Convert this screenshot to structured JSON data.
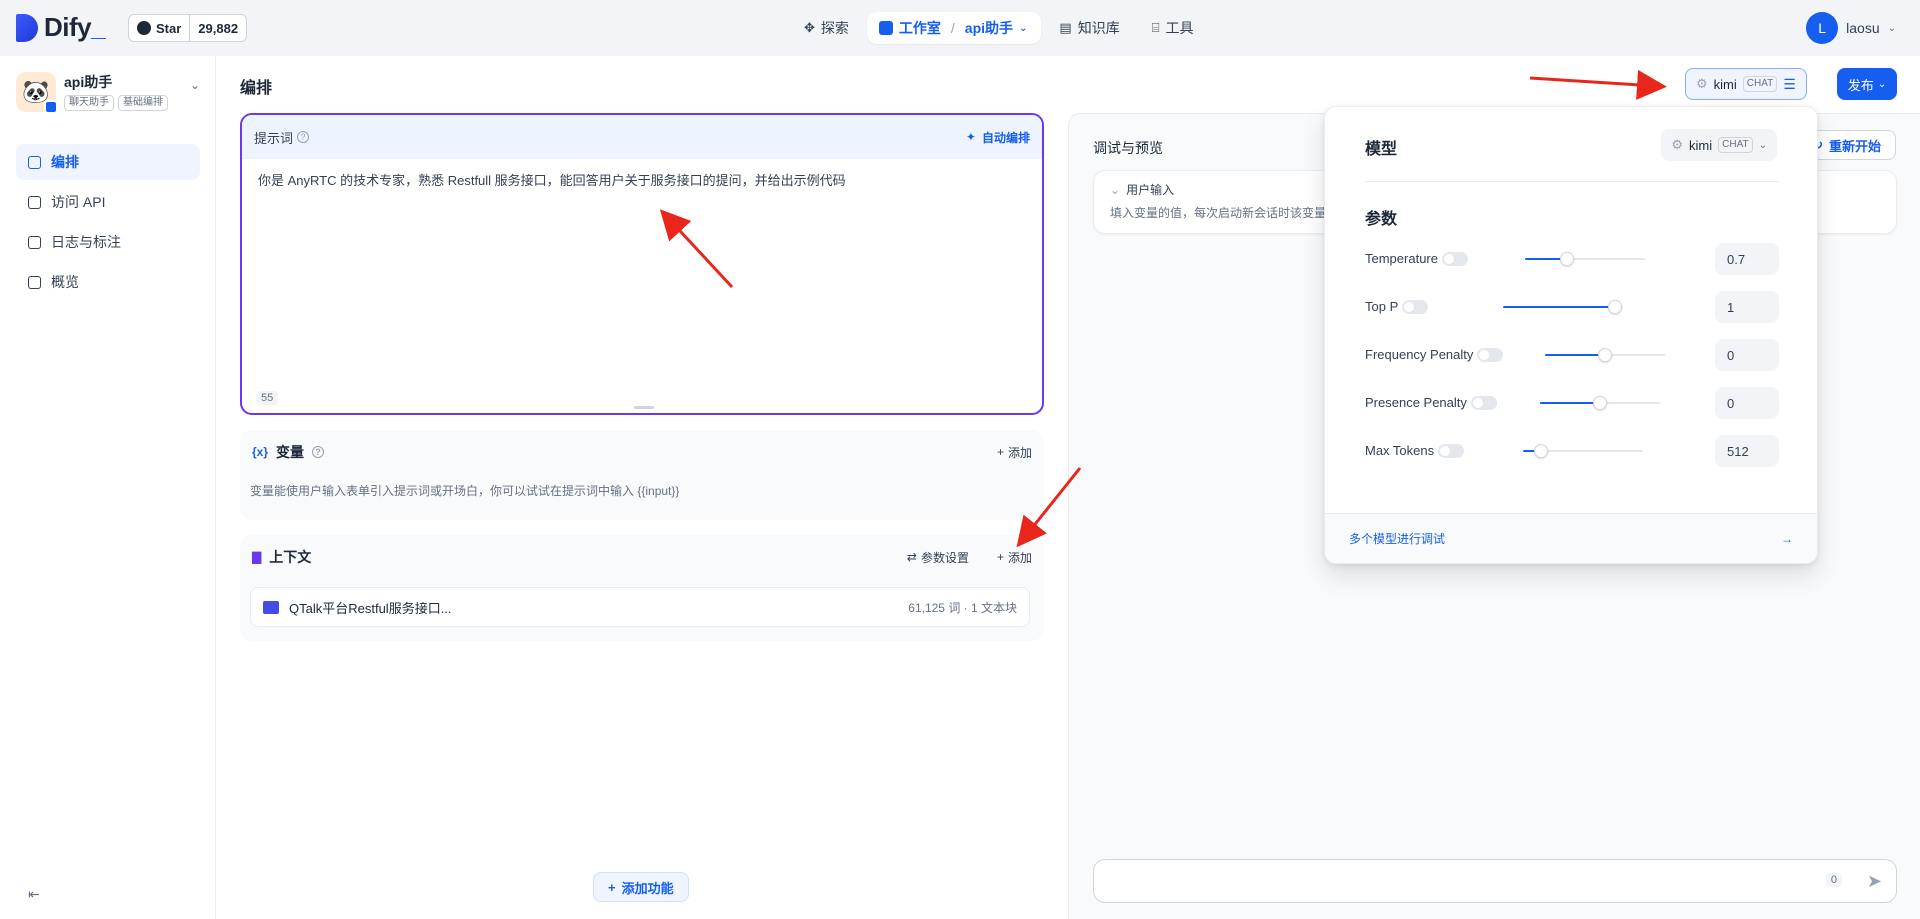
{
  "header": {
    "logo_text": "Dify",
    "github": {
      "label": "Star",
      "count": "29,882"
    },
    "nav": [
      {
        "label": "探索",
        "icon": "compass-icon"
      },
      {
        "label": "工作室",
        "icon": "robot-icon",
        "current_app": "api助手"
      },
      {
        "label": "知识库",
        "icon": "book-icon"
      },
      {
        "label": "工具",
        "icon": "tool-icon"
      }
    ],
    "user": {
      "initial": "L",
      "name": "laosu"
    }
  },
  "sidebar": {
    "app": {
      "name": "api助手",
      "tags": [
        "聊天助手",
        "基础编排"
      ]
    },
    "items": [
      {
        "label": "编排",
        "active": true
      },
      {
        "label": "访问 API",
        "active": false
      },
      {
        "label": "日志与标注",
        "active": false
      },
      {
        "label": "概览",
        "active": false
      }
    ]
  },
  "main": {
    "title": "编排",
    "model_button": {
      "name": "kimi",
      "badge": "CHAT"
    },
    "publish_label": "发布",
    "prompt": {
      "title": "提示词",
      "auto_label": "自动编排",
      "text": "你是 AnyRTC 的技术专家，熟悉 Restfull 服务接口，能回答用户关于服务接口的提问，并给出示例代码",
      "count": "55"
    },
    "variables": {
      "title": "变量",
      "add_label": "添加",
      "desc": "变量能使用户输入表单引入提示词或开场白，你可以试试在提示词中输入 {{input}}"
    },
    "context": {
      "title": "上下文",
      "settings_label": "参数设置",
      "add_label": "添加",
      "doc": {
        "name": "QTalk平台Restful服务接口...",
        "meta": "61,125 词 · 1 文本块"
      }
    },
    "add_feature_label": "添加功能"
  },
  "debug": {
    "title": "调试与预览",
    "restart_label": "重新开始",
    "user_input_title": "用户输入",
    "user_input_desc": "填入变量的值，每次启动新会话时该变量",
    "char_count": "0"
  },
  "popover": {
    "model_title": "模型",
    "model": {
      "name": "kimi",
      "badge": "CHAT"
    },
    "params_title": "参数",
    "params": [
      {
        "label": "Temperature",
        "value": "0.7",
        "fraction": 0.35
      },
      {
        "label": "Top P",
        "value": "1",
        "fraction": 0.93
      },
      {
        "label": "Frequency Penalty",
        "value": "0",
        "fraction": 0.5
      },
      {
        "label": "Presence Penalty",
        "value": "0",
        "fraction": 0.5
      },
      {
        "label": "Max Tokens",
        "value": "512",
        "fraction": 0.15
      }
    ],
    "footer_label": "多个模型进行调试"
  },
  "colors": {
    "primary": "#155eef",
    "prompt_border": "#6938ef",
    "arrow": "#e8261c"
  }
}
